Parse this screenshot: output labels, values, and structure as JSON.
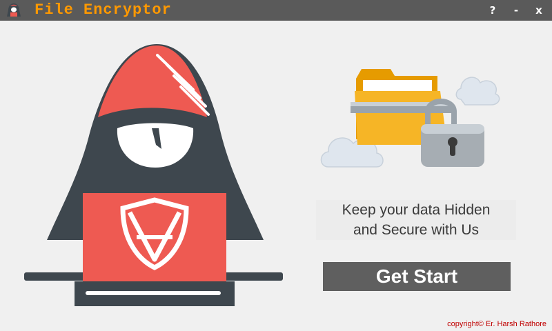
{
  "window": {
    "title": "File Encryptor",
    "help_label": "?",
    "minimize_label": "-",
    "close_label": "x"
  },
  "main": {
    "tagline_line1": "Keep your data Hidden",
    "tagline_line2": "and Secure with Us",
    "start_button_label": "Get Start"
  },
  "footer": {
    "copyright": "copyright© Er. Harsh Rathore"
  },
  "colors": {
    "titlebar": "#5a5a5a",
    "title_text": "#ff9900",
    "hood": "#3e474e",
    "accent_red": "#ee5a52",
    "button": "#5f5f5f",
    "copyright": "#c00000"
  },
  "icons": [
    "hacker-logo-icon",
    "hacker-illustration",
    "locked-folder-illustration"
  ]
}
